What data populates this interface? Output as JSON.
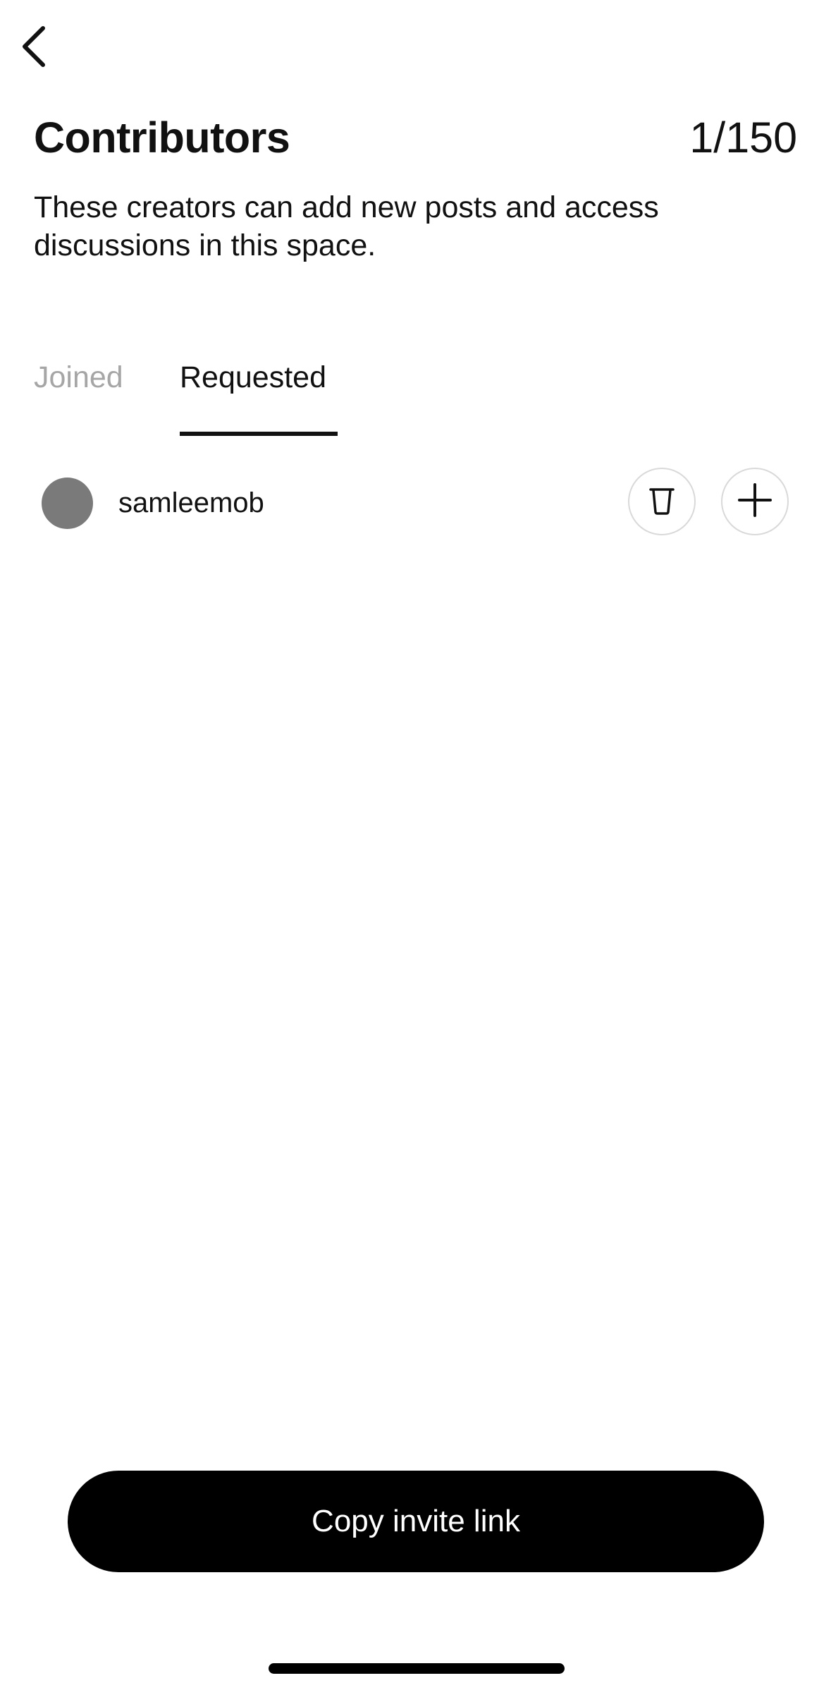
{
  "nav": {
    "back_icon": "chevron-left-icon"
  },
  "header": {
    "title": "Contributors",
    "count": "1/150",
    "description": "These creators can add new posts and access discussions in this space."
  },
  "tabs": [
    {
      "label": "Joined",
      "active": false
    },
    {
      "label": "Requested",
      "active": true
    }
  ],
  "requests": [
    {
      "username": "samleemob",
      "avatar_color": "#7a7a7a",
      "actions": {
        "delete_icon": "trash-icon",
        "add_icon": "plus-icon"
      }
    }
  ],
  "footer": {
    "copy_invite_label": "Copy invite link"
  },
  "colors": {
    "text": "#111111",
    "inactive_tab": "#a6a6a6",
    "button_bg": "#000000",
    "button_text": "#ffffff",
    "circle_border": "#d9d9d9"
  }
}
